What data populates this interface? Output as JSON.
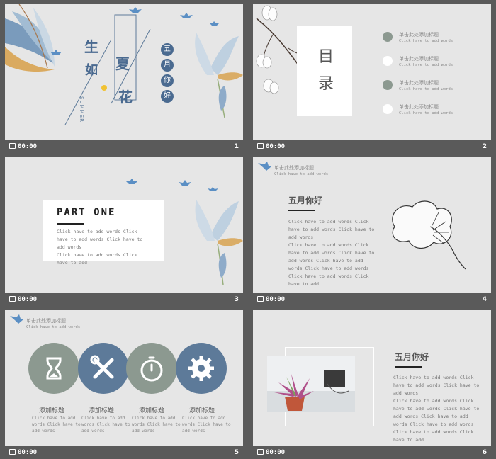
{
  "slides": [
    {
      "time": "00:00",
      "num": "1",
      "title_chars": [
        "生",
        "如",
        "夏",
        "花"
      ],
      "summer": "SUMMER",
      "side_chars": [
        "五",
        "月",
        "你",
        "好"
      ]
    },
    {
      "time": "00:00",
      "num": "2",
      "toc_title": [
        "目",
        "录"
      ],
      "items": [
        {
          "title": "单击此处添加标题",
          "sub": "Click have to add words"
        },
        {
          "title": "单击此处添加标题",
          "sub": "Click have to add words"
        },
        {
          "title": "单击此处添加标题",
          "sub": "Click have to add words"
        },
        {
          "title": "单击此处添加标题",
          "sub": "Click have to add words"
        }
      ]
    },
    {
      "time": "00:00",
      "num": "3",
      "part": "PART ONE",
      "body": [
        "Click have to add words Click",
        "have to add words Click have to",
        "add words",
        "Click have to add words Click",
        "have to add"
      ]
    },
    {
      "time": "00:00",
      "num": "4",
      "header": "单击此处添加标题",
      "header_sub": "Click have to add words",
      "title": "五月你好",
      "body": [
        "Click have to add words Click",
        "have to add words Click have to",
        "add words",
        "Click have to add words Click",
        "have to add words Click have to",
        "add words Click have to add",
        "words Click have to add words",
        "Click have to add words Click",
        "have to add"
      ]
    },
    {
      "time": "00:00",
      "num": "5",
      "header": "单击此处添加标题",
      "header_sub": "Click have to add words",
      "cols": [
        {
          "icon": "hourglass-icon",
          "label": "添加标题",
          "text": [
            "Click have to add",
            "words Click have to",
            "add words"
          ]
        },
        {
          "icon": "tools-icon",
          "label": "添加标题",
          "text": [
            "Click have to add",
            "words Click have to",
            "add words"
          ]
        },
        {
          "icon": "stopwatch-icon",
          "label": "添加标题",
          "text": [
            "Click have to add",
            "words Click have to",
            "add words"
          ]
        },
        {
          "icon": "gear-icon",
          "label": "添加标题",
          "text": [
            "Click have to add",
            "words Click have to",
            "add words"
          ]
        }
      ]
    },
    {
      "time": "00:00",
      "num": "6",
      "title": "五月你好",
      "body": [
        "Click have to add words Click",
        "have to add words Click have to",
        "add words",
        "Click have to add words Click",
        "have to add words Click have to",
        "add words Click have to add",
        "words Click have to add words",
        "Click have to add words Click",
        "have to add"
      ]
    }
  ],
  "colors": {
    "blue": "#5d7a99",
    "gray": "#8c9990",
    "accent": "#4a6a90"
  }
}
